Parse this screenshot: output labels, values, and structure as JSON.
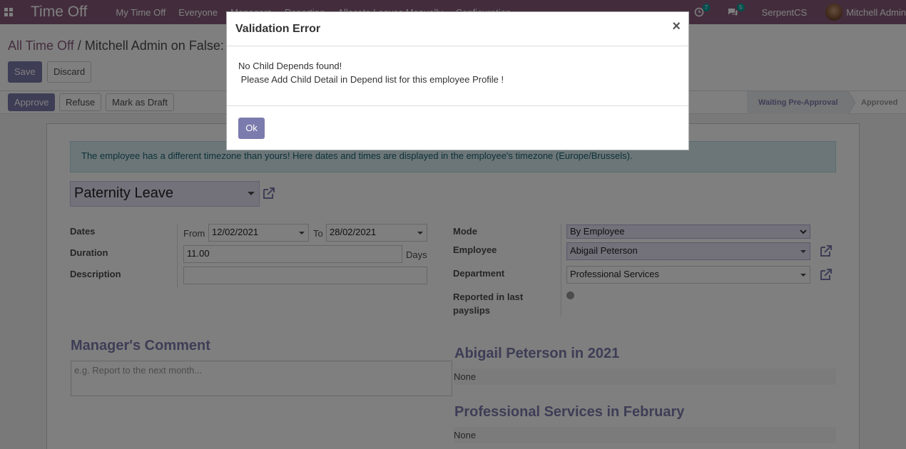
{
  "navbar": {
    "app_title": "Time Off",
    "menu": [
      "My Time Off",
      "Everyone",
      "Managers",
      "Reporting",
      "Allocate Leaves Manually",
      "Configuration"
    ],
    "activity_count": "7",
    "message_count": "5",
    "company": "SerpentCS",
    "user": "Mitchell Admin"
  },
  "breadcrumb": {
    "parent": "All Time Off",
    "separator": "/",
    "current": "Mitchell Admin on False:"
  },
  "control": {
    "save": "Save",
    "discard": "Discard"
  },
  "statusbar": {
    "approve": "Approve",
    "refuse": "Refuse",
    "draft": "Mark as Draft",
    "stage_active": "Waiting Pre-Approval",
    "stage_next": "Approved"
  },
  "sheet": {
    "timezone_alert": "The employee has a different timezone than yours! Here dates and times are displayed in the employee's timezone (Europe/Brussels).",
    "leave_type": "Paternity Leave",
    "dates_label": "Dates",
    "from_label": "From",
    "from_value": "12/02/2021",
    "to_label": "To",
    "to_value": "28/02/2021",
    "duration_label": "Duration",
    "duration_value": "11.00",
    "duration_unit": "Days",
    "description_label": "Description",
    "description_value": "",
    "mode_label": "Mode",
    "mode_value": "By Employee",
    "employee_label": "Employee",
    "employee_value": "Abigail Peterson",
    "department_label": "Department",
    "department_value": "Professional Services",
    "reported_label_1": "Reported in last",
    "reported_label_2": "payslips",
    "manager_comment_title": "Manager's Comment",
    "manager_comment_placeholder": "e.g. Report to the next month...",
    "employee_year_title": "Abigail Peterson in 2021",
    "employee_year_value": "None",
    "department_month_title": "Professional Services in February",
    "department_month_value": "None"
  },
  "modal": {
    "title": "Validation Error",
    "close": "×",
    "line1": "No Child Depends found!",
    "line2": " Please Add Child Detail in Depend list for this employee Profile !",
    "ok": "Ok"
  }
}
